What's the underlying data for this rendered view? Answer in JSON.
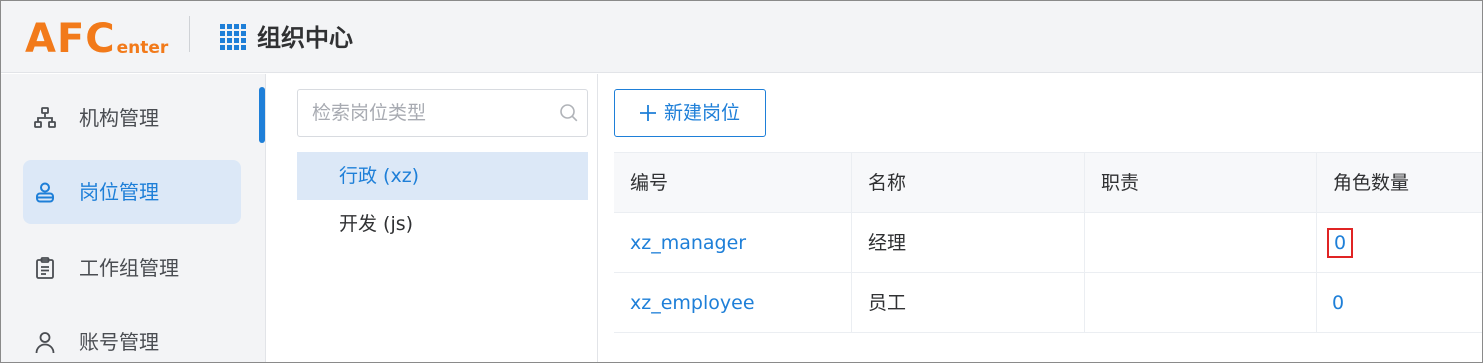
{
  "header": {
    "logo_big": "AFC",
    "logo_small": "enter",
    "app_title": "组织中心"
  },
  "sidebar": {
    "items": [
      {
        "label": "机构管理",
        "icon": "org-chart-icon",
        "active": false
      },
      {
        "label": "岗位管理",
        "icon": "position-user-icon",
        "active": true
      },
      {
        "label": "工作组管理",
        "icon": "clipboard-icon",
        "active": false
      },
      {
        "label": "账号管理",
        "icon": "user-icon",
        "active": false
      }
    ]
  },
  "types_panel": {
    "search_placeholder": "检索岗位类型",
    "types": [
      {
        "label": "行政 (xz)",
        "selected": true
      },
      {
        "label": "开发 (js)",
        "selected": false
      }
    ]
  },
  "toolbar": {
    "new_button_label": "新建岗位"
  },
  "table": {
    "columns": [
      "编号",
      "名称",
      "职责",
      "角色数量"
    ],
    "rows": [
      {
        "code": "xz_manager",
        "name": "经理",
        "duty": "",
        "role_count": "0",
        "highlighted": true
      },
      {
        "code": "xz_employee",
        "name": "员工",
        "duty": "",
        "role_count": "0",
        "highlighted": false
      }
    ]
  },
  "colors": {
    "brand_orange": "#f27a1a",
    "accent_blue": "#1e7fd8",
    "highlight_red": "#e02424"
  }
}
